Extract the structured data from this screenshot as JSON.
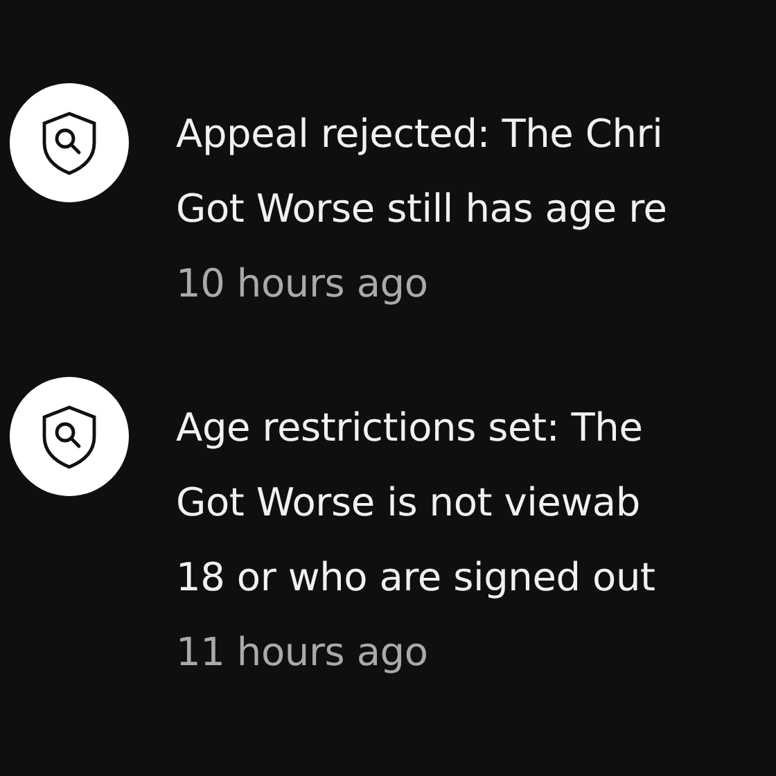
{
  "notifications": [
    {
      "lines": [
        "Appeal rejected: The Chri",
        "Got Worse still has age re"
      ],
      "time": "10 hours ago"
    },
    {
      "lines": [
        "Age restrictions set: The",
        "Got Worse is not viewab",
        "18 or who are signed out"
      ],
      "time": "11 hours ago"
    }
  ]
}
